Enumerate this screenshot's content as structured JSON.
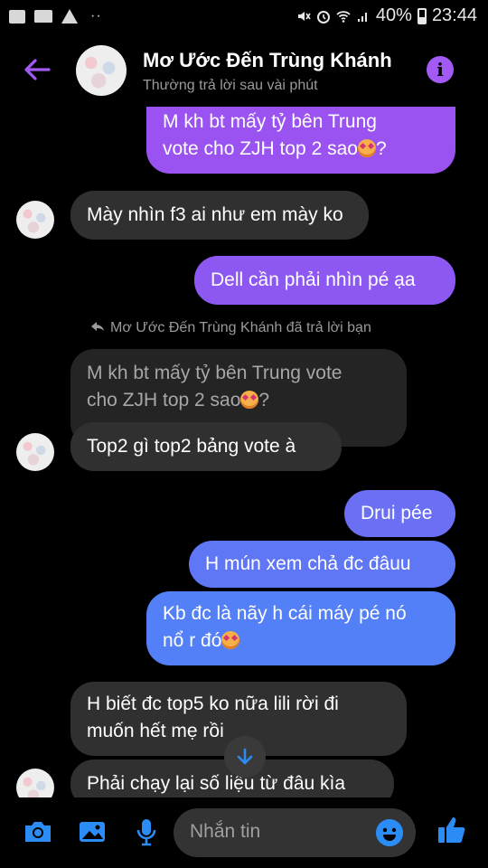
{
  "status": {
    "battery": "40%",
    "time": "23:44",
    "dots": "··"
  },
  "header": {
    "title": "Mơ Ước Đến Trùng Khánh",
    "subtitle": "Thường trả lời sau vài phút",
    "info": "i"
  },
  "messages": {
    "m1_l1": "M kh bt mấy tỷ bên Trung",
    "m1_l2": "vote cho ZJH top 2 sao",
    "m1_q": "?",
    "m2": "Mày nhìn f3 ai như em mày ko",
    "m3": "Dell cần phải nhìn pé ạa",
    "reply_hint": "Mơ Ước Đến Trùng Khánh đã trả lời bạn",
    "quoted_l1": "M kh bt mấy tỷ bên Trung vote",
    "quoted_l2": "cho ZJH top 2 sao",
    "quoted_q": "?",
    "m4": "Top2 gì top2 bảng vote à",
    "m5": "Drui pée",
    "m6": "H mún xem chả đc đâuu",
    "m7_l1": "Kb đc là nãy h cái máy pé nó",
    "m7_l2": "nổ r đó",
    "m8_l1": "H biết đc top5 ko nữa lili rời đi",
    "m8_l2": "muốn hết mẹ rồi",
    "m9": "Phải chạy lại số liệu từ đâu kìa"
  },
  "composer": {
    "placeholder": "Nhắn tin"
  },
  "colors": {
    "accent": "#a35af5",
    "outgoing_top": "#9a53f0",
    "outgoing_bottom": "#4f82f7",
    "incoming": "#303030",
    "icon_blue": "#2b8cf6"
  }
}
